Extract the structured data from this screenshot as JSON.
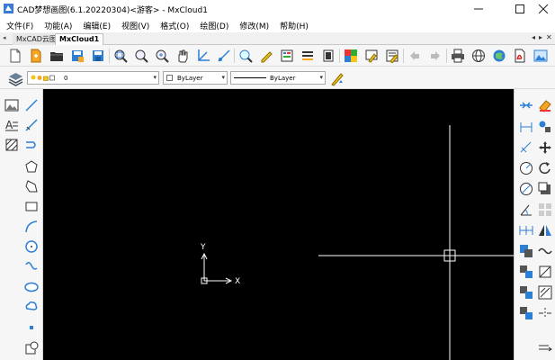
{
  "window": {
    "title": "CAD梦想画图(6.1.20220304)<游客> - MxCloud1",
    "minimize_label": "—",
    "maximize_label": "☐",
    "close_label": "✕"
  },
  "menu": [
    "文件(F)",
    "功能(A)",
    "编辑(E)",
    "视图(V)",
    "格式(O)",
    "绘图(D)",
    "修改(M)",
    "帮助(H)"
  ],
  "tabs": {
    "scroll_left": "◂",
    "items": [
      {
        "label": "MxCAD云图",
        "active": false
      },
      {
        "label": "MxCloud1",
        "active": true
      }
    ],
    "controls": [
      "◂",
      "▸",
      "✕"
    ]
  },
  "layer_toolbar": {
    "layer_value": "0",
    "color_value": "ByLayer",
    "linetype_value": "ByLayer",
    "dropdown_arrow": "▾"
  },
  "ucs": {
    "x_label": "X",
    "y_label": "Y"
  },
  "icons": {
    "toolbar_main": [
      "new-file-icon",
      "open-file-icon",
      "open-folder-icon",
      "save-as-icon",
      "save-icon",
      "zoom-window-icon",
      "zoom-extents-icon",
      "zoom-realtime-icon",
      "pan-hand-icon",
      "ucs-axes-icon",
      "zoom-previous-icon",
      "pen-edit-icon",
      "layer-properties-icon",
      "layer-states-icon",
      "layer-off-icon",
      "color-settings-icon",
      "layer-match-icon",
      "properties-palette-icon",
      "undo-icon",
      "redo-icon",
      "print-icon",
      "web-globe-icon",
      "cloud-globe-icon",
      "pdf-export-icon",
      "image-export-icon"
    ],
    "left_panel": [
      "image-insert-icon",
      "line-icon",
      "text-icon",
      "construction-line-icon",
      "hatch-icon",
      "polyline-icon",
      "polygon-icon",
      "pentagon-icon",
      "rectangle-icon",
      "arc-icon",
      "circle-icon",
      "spline-icon",
      "ellipse-icon",
      "revision-cloud-icon",
      "point-icon",
      "block-insert-icon"
    ],
    "right_panel": [
      "trim-icon",
      "eraser-icon",
      "dimension-linear-icon",
      "copy-objects-icon",
      "dimension-aligned-icon",
      "move-icon",
      "dimension-radius-icon",
      "rotate-icon",
      "dimension-diameter-icon",
      "offset-icon",
      "dimension-angular-icon",
      "array-icon",
      "continue-dim-icon",
      "mirror-icon",
      "stretch-icon",
      "explode-icon",
      "fillet-icon",
      "scale-icon",
      "chamfer-icon",
      "measure-icon",
      "extend-icon",
      "break-icon"
    ]
  },
  "colors": {
    "canvas_background": "#000000",
    "crosshair": "#ffffff",
    "accent_blue": "#2d7fd3"
  }
}
